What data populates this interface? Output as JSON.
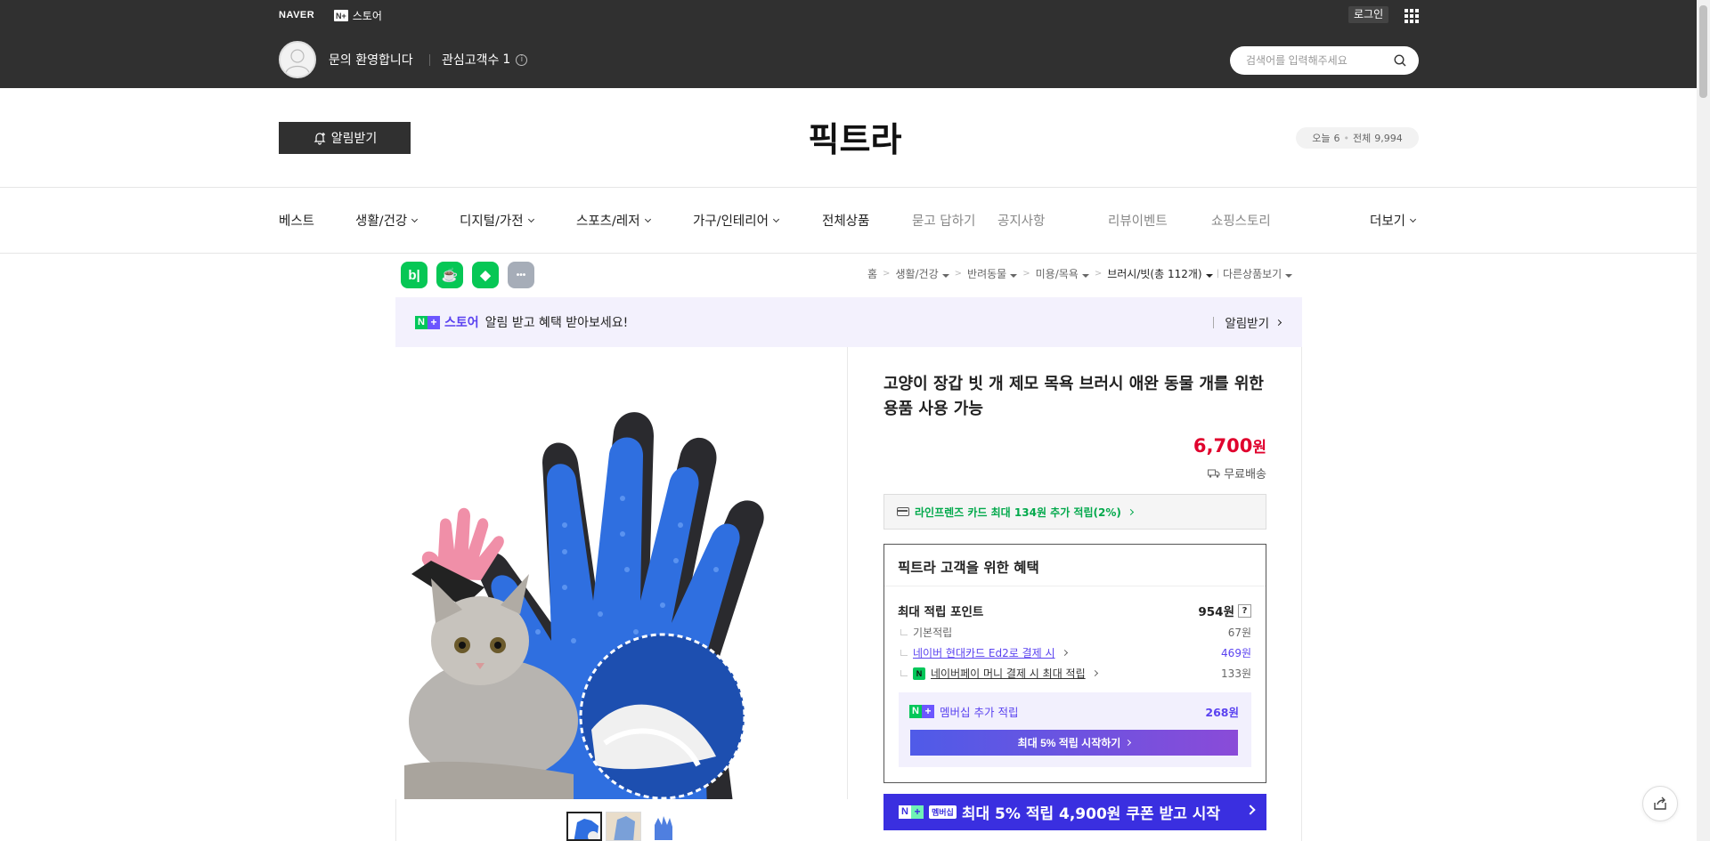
{
  "gnb": {
    "naver_logo": "NAVER",
    "nplus_badge": "N+",
    "nplus_store": "스토어",
    "login": "로그인",
    "apps_icon": "apps-grid-icon"
  },
  "store_bar": {
    "welcome": "문의 환영합니다",
    "fav_label": "관심고객수",
    "fav_count": "1",
    "search_placeholder": "검색어를 입력해주세요"
  },
  "header": {
    "alarm_button": "알림받기",
    "store_name": "픽트라",
    "visitors_today_label": "오늘",
    "visitors_today": "6",
    "visitors_total_label": "전체",
    "visitors_total": "9,994"
  },
  "nav": {
    "items": [
      {
        "label": "베스트",
        "dropdown": false,
        "muted": false
      },
      {
        "label": "생활/건강",
        "dropdown": true,
        "muted": false
      },
      {
        "label": "디지털/가전",
        "dropdown": true,
        "muted": false
      },
      {
        "label": "스포츠/레저",
        "dropdown": true,
        "muted": false
      },
      {
        "label": "가구/인테리어",
        "dropdown": true,
        "muted": false
      },
      {
        "label": "전체상품",
        "dropdown": false,
        "muted": false
      },
      {
        "label": "묻고 답하기",
        "dropdown": false,
        "muted": true
      },
      {
        "label": "공지사항",
        "dropdown": false,
        "muted": true
      },
      {
        "label": "리뷰이벤트",
        "dropdown": false,
        "muted": true
      },
      {
        "label": "쇼핑스토리",
        "dropdown": false,
        "muted": true
      }
    ],
    "more": "더보기"
  },
  "share_icons": [
    {
      "name": "band-share-icon",
      "glyph": "b|",
      "color": "#06c755"
    },
    {
      "name": "cafe-share-icon",
      "glyph": "☕",
      "color": "#06c755"
    },
    {
      "name": "blog-share-icon",
      "glyph": "◆",
      "color": "#06c755"
    },
    {
      "name": "more-share-icon",
      "glyph": "•••",
      "color": "#a6adb8"
    }
  ],
  "breadcrumb": {
    "home": "홈",
    "items": [
      "생활/건강",
      "반려동물",
      "미용/목욕",
      "브러시/빗(총 112개)"
    ],
    "other": "다른상품보기"
  },
  "banner": {
    "store": "스토어",
    "text": "알림 받고 혜택 받아보세요!",
    "action": "알림받기"
  },
  "product": {
    "title": "고양이 장갑 빗 개 제모 목욕 브러시 애완 동물 개를 위한 용품 사용 가능",
    "price": "6,700",
    "price_unit": "원",
    "shipping": "무료배송",
    "card_promo": "라인프렌즈 카드 최대 134원 추가 적립(2%)"
  },
  "benefit": {
    "title": "픽트라 고객을 위한 혜택",
    "max_point_label": "최대 적립 포인트",
    "max_point": "954원",
    "rows": [
      {
        "label": "기본적립",
        "value": "67원",
        "link": false
      },
      {
        "label": "네이버 현대카드 Ed2로 결제 시",
        "value": "469원",
        "link": true
      },
      {
        "label": "네이버페이 머니 결제 시 최대 적립",
        "value": "133원",
        "link": false
      }
    ],
    "membership_label": "멤버십 추가 적립",
    "membership_value": "268원",
    "membership_button": "최대 5% 적립 시작하기"
  },
  "coupon": {
    "member_tag": "멤버십",
    "text": "최대 5% 적립 4,900원 쿠폰 받고 시작"
  },
  "colors": {
    "dark_bar": "#303030",
    "price_red": "#e0012d",
    "naver_green": "#03c75a",
    "purple": "#5a42f0",
    "coupon_bg": "#3a2fe0"
  }
}
